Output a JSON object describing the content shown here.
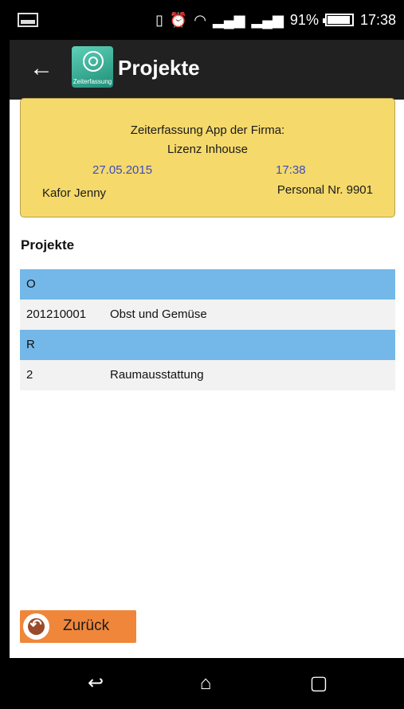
{
  "status_bar": {
    "battery": "91%",
    "time": "17:38",
    "icons": [
      "vibrate-icon",
      "alarm-icon",
      "wifi-icon",
      "signal-1-icon",
      "signal-2-icon",
      "battery-icon"
    ]
  },
  "action_bar": {
    "title": "Projekte",
    "app_icon_label": "Zeiterfassung"
  },
  "info_card": {
    "title": "Zeiterfassung App der Firma:",
    "license": "Lizenz Inhouse",
    "date": "27.05.2015",
    "time": "17:38",
    "name": "Kafor Jenny",
    "personal_nr": "Personal Nr. 9901"
  },
  "section": {
    "heading": "Projekte"
  },
  "projects": [
    {
      "type": "group",
      "label": "O"
    },
    {
      "type": "item",
      "number": "201210001",
      "name": "Obst und Gemüse"
    },
    {
      "type": "group",
      "label": "R"
    },
    {
      "type": "item",
      "number": "2",
      "name": "Raumausstattung"
    }
  ],
  "back_button": {
    "label": "Zurück"
  },
  "colors": {
    "card_background": "#f5d96b",
    "group_header": "#73b8e8",
    "item_background": "#f2f2f2",
    "accent_blue": "#3a4dc0",
    "button_orange": "#f0863a",
    "action_bar": "#212121"
  }
}
